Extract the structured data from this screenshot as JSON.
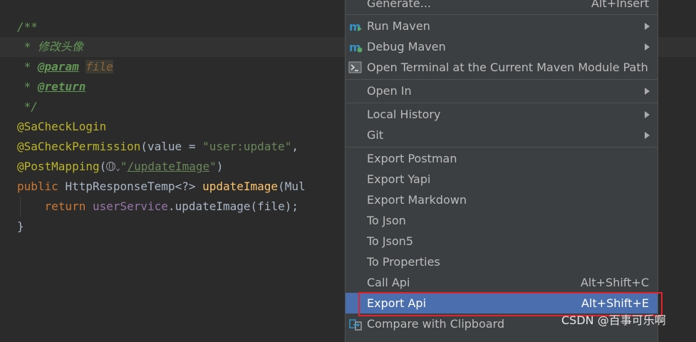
{
  "editor": {
    "lines": [
      {
        "tokens": [
          {
            "c": "tok-comment",
            "t": "/**"
          }
        ]
      },
      {
        "tokens": [
          {
            "c": "tok-comment",
            "t": " * 修改头像"
          }
        ]
      },
      {
        "tokens": [
          {
            "c": "tok-comment",
            "t": " * "
          },
          {
            "c": "tok-tag",
            "t": "@param"
          },
          {
            "c": "tok-comment",
            "t": " "
          },
          {
            "c": "tok-param",
            "t": "file"
          }
        ]
      },
      {
        "tokens": [
          {
            "c": "tok-comment",
            "t": " * "
          },
          {
            "c": "tok-tag",
            "t": "@return"
          }
        ]
      },
      {
        "tokens": [
          {
            "c": "tok-comment",
            "t": " */"
          }
        ]
      },
      {
        "tokens": [
          {
            "c": "tok-annot",
            "t": "@SaCheckLogin"
          }
        ]
      },
      {
        "tokens": [
          {
            "c": "tok-annot",
            "t": "@SaCheckPermission"
          },
          {
            "c": "tok-plain",
            "t": "(value = "
          },
          {
            "c": "tok-string",
            "t": "\"user:update\""
          },
          {
            "c": "tok-plain",
            "t": ","
          }
        ]
      },
      {
        "tokens": [
          {
            "c": "tok-annot",
            "t": "@PostMapping"
          },
          {
            "c": "tok-plain",
            "t": "("
          },
          {
            "c": "globe"
          },
          {
            "c": "tok-chev",
            "t": "⌄"
          },
          {
            "c": "tok-string",
            "t": "\""
          },
          {
            "c": "tok-link",
            "t": "/updateImage"
          },
          {
            "c": "tok-string",
            "t": "\""
          },
          {
            "c": "tok-plain",
            "t": ")"
          }
        ]
      },
      {
        "tokens": [
          {
            "c": "tok-kw",
            "t": "public "
          },
          {
            "c": "tok-plain",
            "t": "HttpResponseTemp<?> "
          },
          {
            "c": "tok-method",
            "t": "updateImage"
          },
          {
            "c": "tok-plain",
            "t": "(Mul"
          }
        ]
      },
      {
        "tokens": [
          {
            "c": "tok-plain",
            "t": "    "
          },
          {
            "c": "tok-kw",
            "t": "return "
          },
          {
            "c": "tok-field",
            "t": "userService"
          },
          {
            "c": "tok-plain",
            "t": ".updateImage(file);"
          }
        ]
      },
      {
        "tokens": [
          {
            "c": "tok-plain",
            "t": "}"
          }
        ]
      }
    ]
  },
  "menu": {
    "generate": {
      "label": "Generate...",
      "shortcut": "Alt+Insert"
    },
    "run_maven": {
      "label": "Run Maven"
    },
    "debug_maven": {
      "label": "Debug Maven"
    },
    "open_terminal": {
      "label": "Open Terminal at the Current Maven Module Path"
    },
    "open_in": {
      "label": "Open In"
    },
    "local_history": {
      "label": "Local History"
    },
    "git": {
      "label": "Git"
    },
    "export_postman": {
      "label": "Export Postman"
    },
    "export_yapi": {
      "label": "Export Yapi"
    },
    "export_markdown": {
      "label": "Export Markdown"
    },
    "to_json": {
      "label": "To Json"
    },
    "to_json5": {
      "label": "To Json5"
    },
    "to_properties": {
      "label": "To Properties"
    },
    "call_api": {
      "label": "Call Api",
      "shortcut": "Alt+Shift+C"
    },
    "export_api": {
      "label": "Export Api",
      "shortcut": "Alt+Shift+E"
    },
    "compare_clipboard": {
      "label": "Compare with Clipboard"
    }
  },
  "watermark": "CSDN @百事可乐啊",
  "colors": {
    "editor_bg": "#2b2b2b",
    "menu_bg": "#3c3f41",
    "selection": "#4b6eaf",
    "highlight_box": "#e3232c"
  }
}
